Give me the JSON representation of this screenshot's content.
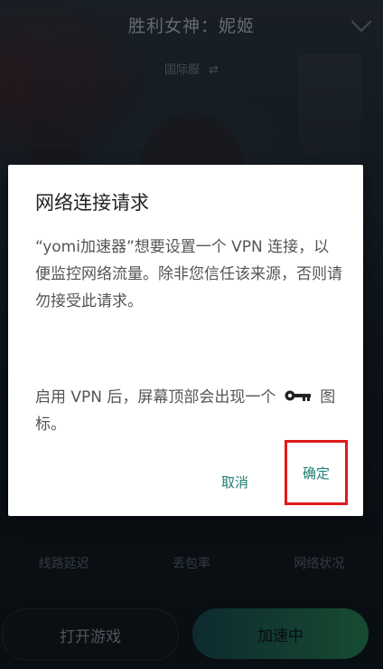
{
  "app": {
    "game_title": "胜利女神：妮姬",
    "server": "国际服",
    "server_switch_icon": "⇄"
  },
  "stats": {
    "latency_label": "线路延迟",
    "packet_loss_label": "丢包率",
    "network_status_label": "网络状况"
  },
  "actions": {
    "open_game_label": "打开游戏",
    "accelerating_label": "加速中"
  },
  "dialog": {
    "title": "网络连接请求",
    "message": "“yomi加速器”想要设置一个 VPN 连接，以便监控网络流量。除非您信任该来源，否则请勿接受此请求。",
    "note_before_icon": "启用 VPN 后，屏幕顶部会出现一个",
    "note_icon": "key-icon",
    "note_after_icon": "图标。",
    "cancel_label": "取消",
    "confirm_label": "确定",
    "accent_color": "#1f7f73",
    "highlight_color": "#e01a1a"
  }
}
